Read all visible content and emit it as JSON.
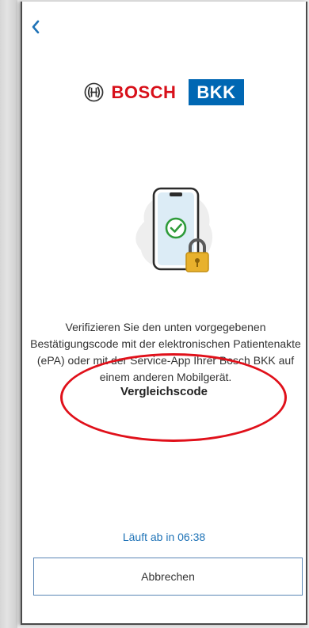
{
  "header": {
    "back_icon": "chevron-left-icon"
  },
  "brand": {
    "bosch": "BOSCH",
    "bkk": "BKK"
  },
  "illustration": {
    "icon": "phone-checkmark-lock-icon"
  },
  "body": {
    "description": "Verifizieren Sie den unten vorgegebenen Bestätigungscode mit der elektronischen Patientenakte (ePA) oder mit der Service-App Ihrer Bosch BKK auf einem anderen Mobilgerät.",
    "compare_title": "Vergleichscode",
    "expiry": "Läuft ab in 06:38"
  },
  "actions": {
    "cancel_label": "Abbrechen"
  },
  "colors": {
    "bosch_red": "#d8101a",
    "bkk_blue": "#0067b3",
    "link_blue": "#1f73b7",
    "success_green": "#2e9b3a",
    "lock_gold": "#e8b12c"
  }
}
